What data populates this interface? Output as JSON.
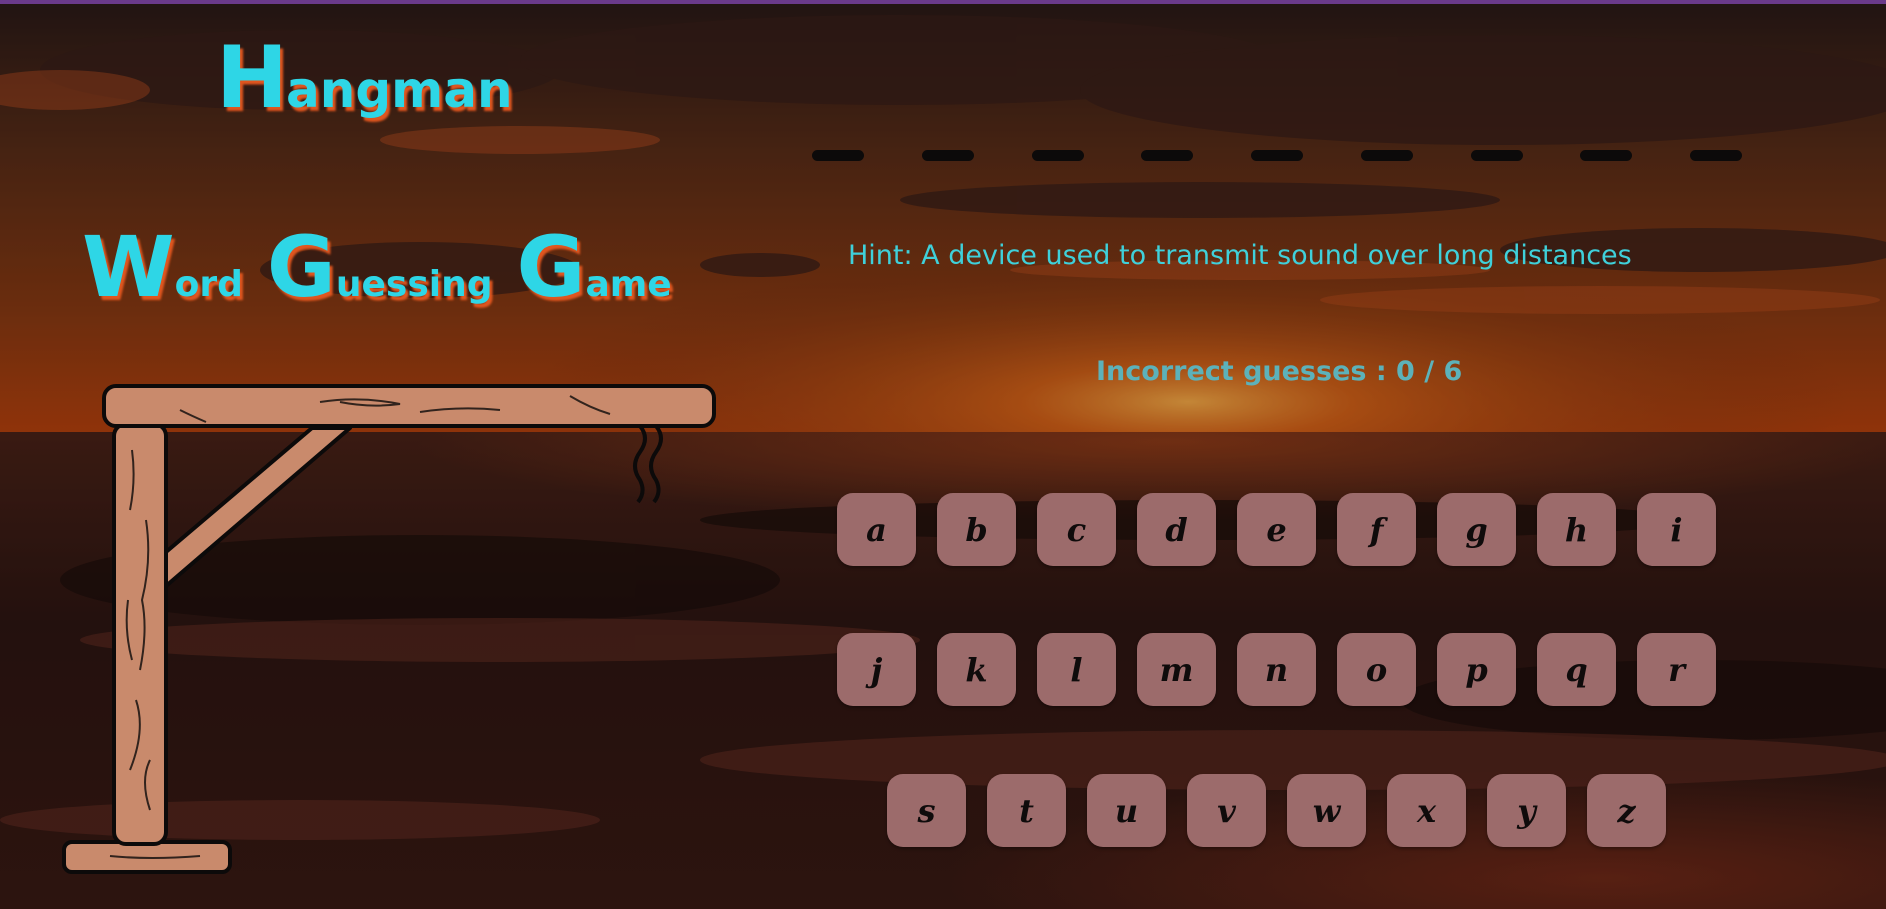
{
  "title": {
    "main": [
      {
        "cap": "H",
        "rest": "angman"
      }
    ],
    "subtitle": [
      {
        "cap": "W",
        "rest": "ord"
      },
      {
        "cap": "G",
        "rest": "uessing"
      },
      {
        "cap": "G",
        "rest": "ame"
      }
    ]
  },
  "word": {
    "length": 9,
    "revealed": [
      "",
      "",
      "",
      "",
      "",
      "",
      "",
      "",
      ""
    ]
  },
  "hint": "Hint: A device used to transmit sound over long distances",
  "guesses": "Incorrect guesses : 0 / 6",
  "keyboard": {
    "rows": [
      [
        "a",
        "b",
        "c",
        "d",
        "e",
        "f",
        "g",
        "h",
        "i"
      ],
      [
        "j",
        "k",
        "l",
        "m",
        "n",
        "o",
        "p",
        "q",
        "r"
      ],
      [
        "s",
        "t",
        "u",
        "v",
        "w",
        "x",
        "y",
        "z"
      ]
    ]
  },
  "colors": {
    "title": "#2ed6e6",
    "title_shadow": "#e0561f",
    "hint": "#3fd0da",
    "key_bg": "#9c6b6b",
    "gallows_wood": "#c98a6c"
  },
  "icons": {
    "background": "sunset-beach-image",
    "gallows": "wooden-gallows-icon",
    "rope": "rope-icon"
  }
}
